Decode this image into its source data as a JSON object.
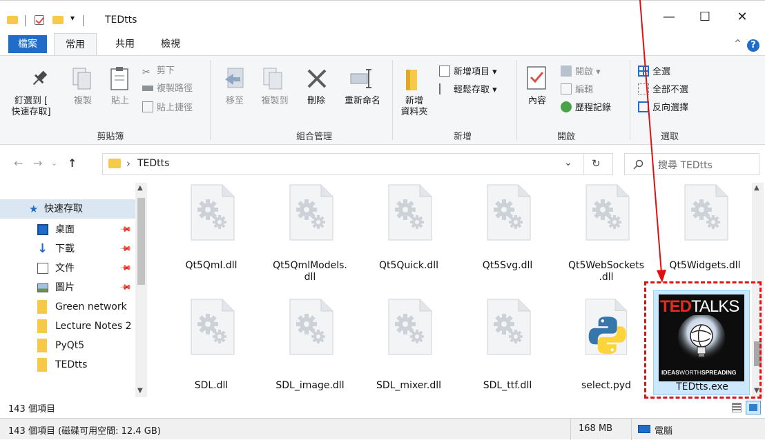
{
  "window": {
    "title": "TEDtts",
    "quick_access_glyph": "▾",
    "minimize": "—",
    "maximize": "☐",
    "close": "✕"
  },
  "ribbon_tabs": {
    "file": "檔案",
    "home": "常用",
    "share": "共用",
    "view": "檢視",
    "collapse": "^",
    "help": "?"
  },
  "ribbon": {
    "clipboard": {
      "label": "剪貼簿",
      "pin": "釘選到 [\n快速存取]",
      "copy": "複製",
      "paste": "貼上",
      "cut": "剪下",
      "copy_path": "複製路徑",
      "paste_shortcut": "貼上捷徑"
    },
    "organize": {
      "label": "組合管理",
      "move_to": "移至",
      "copy_to": "複製到",
      "delete": "刪除",
      "rename": "重新命名"
    },
    "new": {
      "label": "新增",
      "new_folder": "新增\n資料夾",
      "new_item": "新增項目 ▾",
      "easy_access": "輕鬆存取 ▾"
    },
    "open": {
      "label": "開啟",
      "properties": "內容",
      "open": "開啟 ▾",
      "edit": "編輯",
      "history": "歷程記錄"
    },
    "select": {
      "label": "選取",
      "select_all": "全選",
      "select_none": "全部不選",
      "invert": "反向選擇"
    }
  },
  "address": {
    "path_separator": "›",
    "path": "TEDtts",
    "dropdown": "⌄",
    "refresh": "↻",
    "search_placeholder": "搜尋 TEDtts"
  },
  "nav": {
    "quick_access": "快速存取",
    "items": [
      {
        "label": "桌面",
        "pinned": true
      },
      {
        "label": "下載",
        "pinned": true
      },
      {
        "label": "文件",
        "pinned": true
      },
      {
        "label": "圖片",
        "pinned": true
      },
      {
        "label": "Green network",
        "pinned": false
      },
      {
        "label": "Lecture Notes 2",
        "pinned": false
      },
      {
        "label": "PyQt5",
        "pinned": false
      },
      {
        "label": "TEDtts",
        "pinned": false
      }
    ]
  },
  "files": {
    "row1": [
      "Qt5Qml.dll",
      "Qt5QmlModels.\ndll",
      "Qt5Quick.dll",
      "Qt5Svg.dll",
      "Qt5WebSockets\n.dll",
      "Qt5Widgets.dll"
    ],
    "row2": [
      "SDL.dll",
      "SDL_image.dll",
      "SDL_mixer.dll",
      "SDL_ttf.dll",
      "select.pyd",
      "TEDtts.exe"
    ]
  },
  "ted_icon": {
    "brand_red": "TED",
    "brand_white": "TALKS",
    "tagline_ideas": "IDEAS",
    "tagline_worth": "WORTH",
    "tagline_spreading": "SPREADING"
  },
  "status": {
    "item_count": "143 個項目",
    "detail": "143 個項目 (磁碟可用空間: 12.4 GB)",
    "size": "168 MB",
    "location": "電腦"
  },
  "colors": {
    "accent": "#1f6dc9",
    "folder": "#f7c948",
    "annotation": "#e01010",
    "ted_red": "#e62b1e"
  }
}
